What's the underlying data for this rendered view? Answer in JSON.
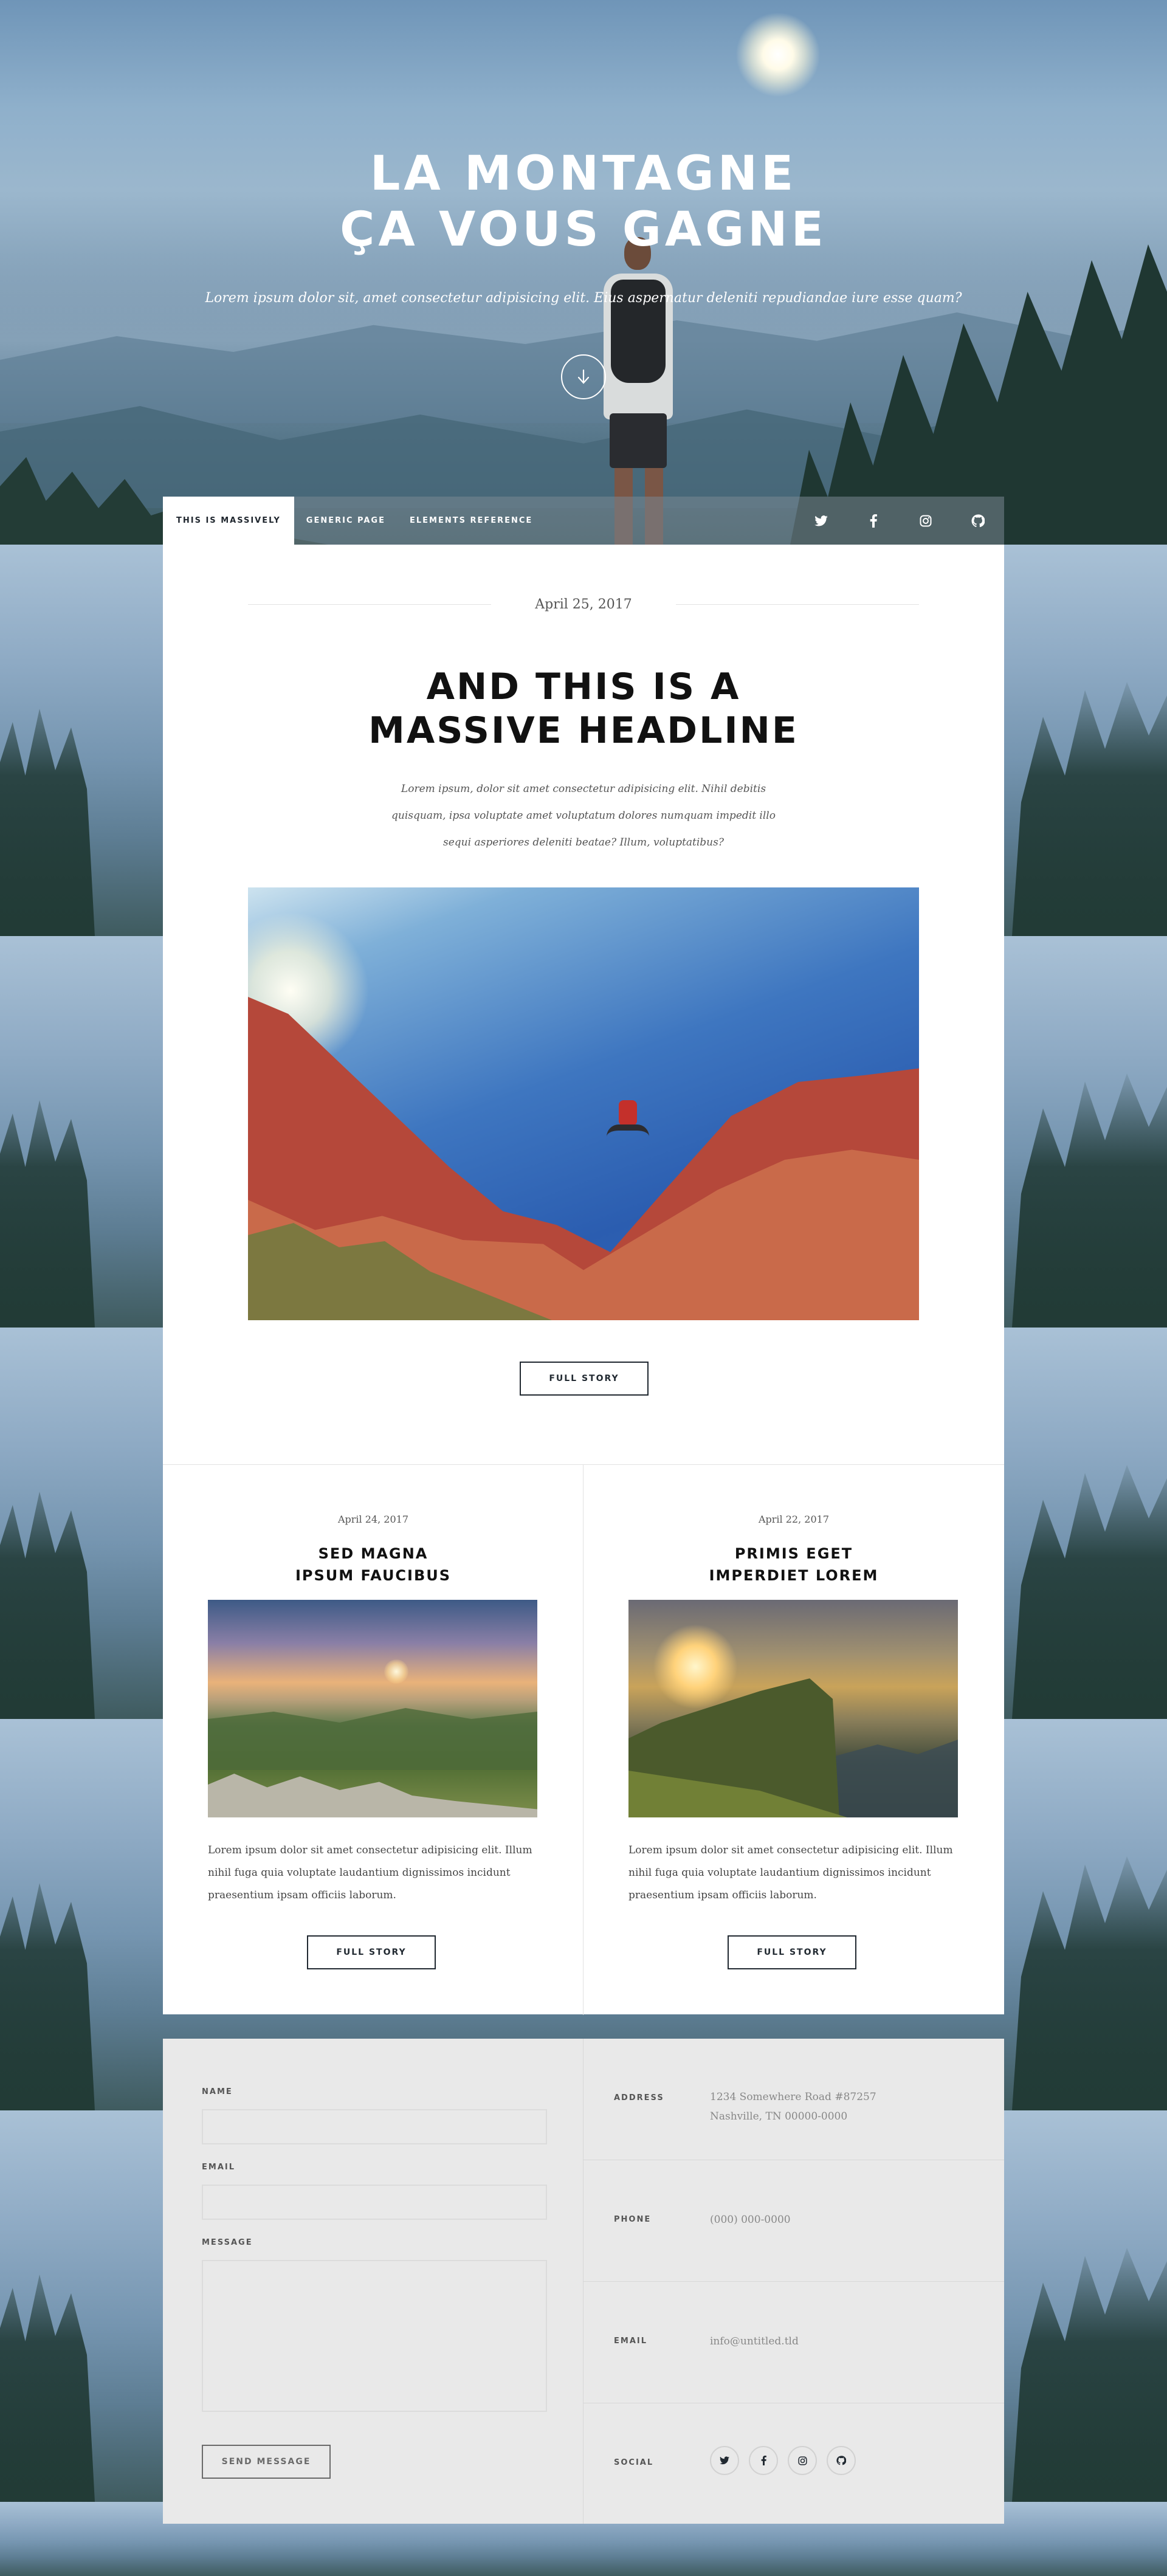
{
  "hero": {
    "title_line1": "LA MONTAGNE",
    "title_line2": "ÇA VOUS GAGNE",
    "subtitle": "Lorem ipsum dolor sit, amet consectetur adipisicing elit. Eius aspernatur deleniti repudiandae iure esse quam?"
  },
  "nav": {
    "items": [
      {
        "label": "THIS IS MASSIVELY",
        "active": true
      },
      {
        "label": "GENERIC PAGE"
      },
      {
        "label": "ELEMENTS REFERENCE"
      }
    ],
    "social": [
      "twitter-icon",
      "facebook-icon",
      "instagram-icon",
      "github-icon"
    ]
  },
  "featured": {
    "date": "April 25, 2017",
    "headline_line1": "AND THIS IS A",
    "headline_line2": "MASSIVE HEADLINE",
    "lede": "Lorem ipsum, dolor sit amet consectetur adipisicing elit. Nihil debitis quisquam, ipsa voluptate amet voluptatum dolores numquam impedit illo sequi asperiores deleniti beatae? Illum, voluptatibus?",
    "button": "FULL STORY"
  },
  "posts": [
    {
      "date": "April 24, 2017",
      "title_line1": "SED MAGNA",
      "title_line2": "IPSUM FAUCIBUS",
      "text": "Lorem ipsum dolor sit amet consectetur adipisicing elit. Illum nihil fuga quia voluptate laudantium dignissimos incidunt praesentium ipsam officiis laborum.",
      "button": "FULL STORY"
    },
    {
      "date": "April 22, 2017",
      "title_line1": "PRIMIS EGET",
      "title_line2": "IMPERDIET LOREM",
      "text": "Lorem ipsum dolor sit amet consectetur adipisicing elit. Illum nihil fuga quia voluptate laudantium dignissimos incidunt praesentium ipsam officiis laborum.",
      "button": "FULL STORY"
    }
  ],
  "contact": {
    "name_label": "NAME",
    "email_label": "EMAIL",
    "message_label": "MESSAGE",
    "send_label": "SEND MESSAGE",
    "address_label": "ADDRESS",
    "address_line1": "1234 Somewhere Road #87257",
    "address_line2": "Nashville, TN 00000-0000",
    "phone_label": "PHONE",
    "phone_value": "(000) 000-0000",
    "email_info_label": "EMAIL",
    "email_value": "info@untitled.tld",
    "social_label": "SOCIAL"
  }
}
